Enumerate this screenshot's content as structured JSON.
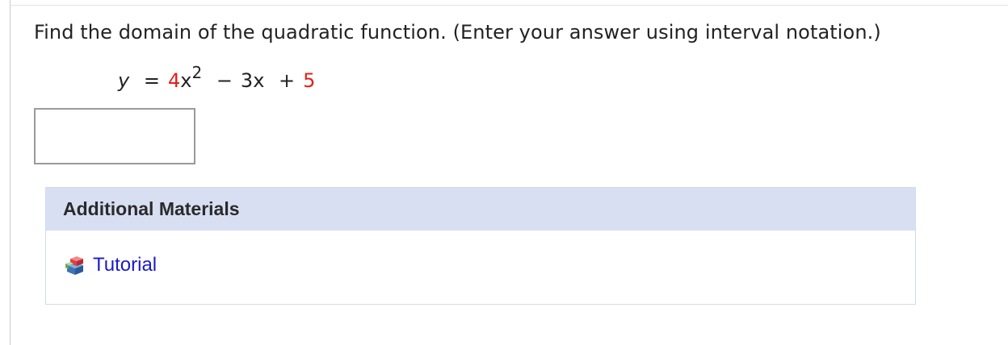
{
  "question": {
    "text": "Find the domain of the quadratic function. (Enter your answer using interval notation.)"
  },
  "equation": {
    "lhs": "y",
    "equals": "=",
    "coef_a": "4",
    "var_x": "x",
    "exponent": "2",
    "minus": "−",
    "term_b": "3x",
    "plus": "+",
    "const_c": "5"
  },
  "answer": {
    "value": "",
    "placeholder": ""
  },
  "additional_materials": {
    "title": "Additional Materials",
    "items": [
      {
        "label": "Tutorial",
        "icon": "tutorial-blocks-icon"
      }
    ]
  },
  "colors": {
    "highlight_red": "#e0221b",
    "link_blue": "#1a1acc",
    "header_bg": "#d8dff3"
  }
}
